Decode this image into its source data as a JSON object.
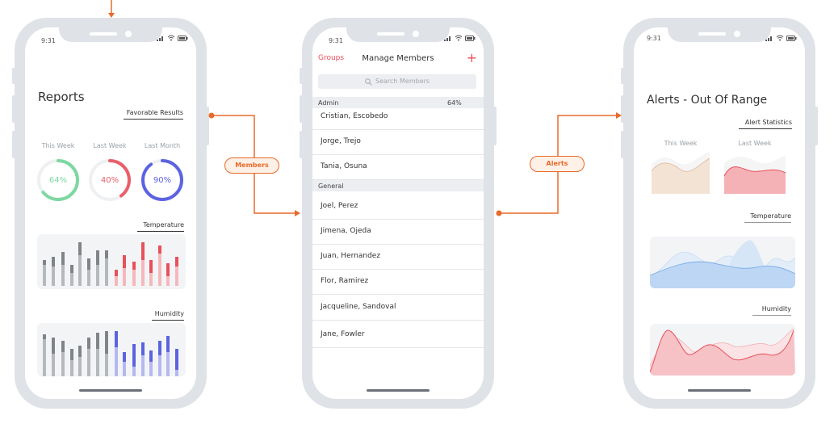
{
  "flow": {
    "members_label": "Members",
    "alerts_label": "Alerts",
    "line_color": "#e86a2a"
  },
  "reports": {
    "status_time": "9:31",
    "title": "Reports",
    "favorable_results": "Favorable Results",
    "periods": [
      {
        "label": "This Week",
        "value": "64%",
        "percent": 64,
        "color": "#7dd8a0"
      },
      {
        "label": "Last Week",
        "value": "40%",
        "percent": 40,
        "color": "#e8606a"
      },
      {
        "label": "Last Month",
        "value": "90%",
        "percent": 90,
        "color": "#5c63e0"
      }
    ],
    "temperature_label": "Temperature",
    "humidity_label": "Humidity"
  },
  "members": {
    "status_time": "9:31",
    "back_label": "Groups",
    "title": "Manage Members",
    "search_placeholder": "Search Members",
    "admin_header": "Admin",
    "admin_percent": "64%",
    "admin_members": [
      "Cristian, Escobedo",
      "Jorge, Trejo",
      "Tania, Osuna"
    ],
    "general_header": "General",
    "general_members": [
      "Joel, Perez",
      "Jimena, Ojeda",
      "Juan, Hernandez",
      "Flor, Ramirez",
      "Jacqueline, Sandoval",
      "Jane, Fowler"
    ],
    "accent_color": "#e8505b"
  },
  "alerts": {
    "status_time": "9:31",
    "title": "Alerts - Out Of Range",
    "alert_statistics": "Alert Statistics",
    "this_week": "This Week",
    "last_week": "Last Week",
    "temperature_label": "Temperature",
    "humidity_label": "Humidity"
  }
}
